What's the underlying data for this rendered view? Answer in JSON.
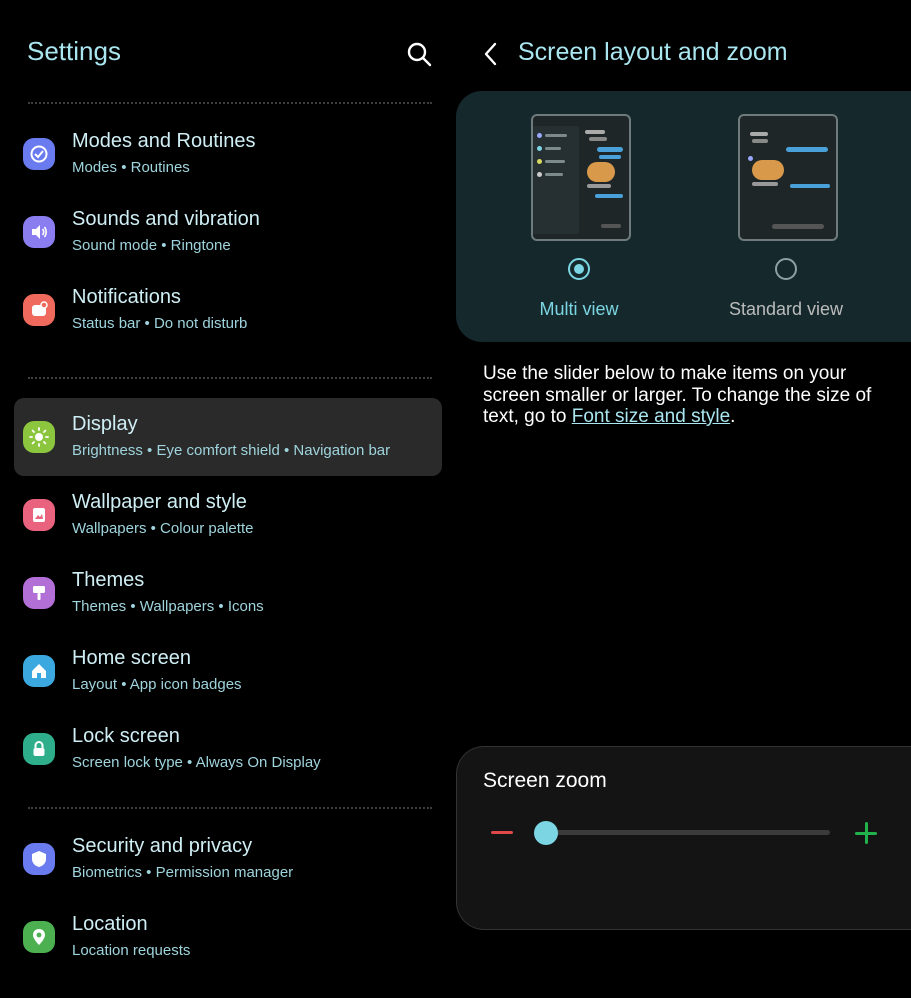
{
  "settings": {
    "title": "Settings",
    "items": [
      {
        "title": "Modes and Routines",
        "sub": "Modes  •  Routines",
        "color": "#6a7bf0",
        "icon": "check-circle-icon"
      },
      {
        "title": "Sounds and vibration",
        "sub": "Sound mode  •  Ringtone",
        "color": "#8a7df0",
        "icon": "speaker-icon"
      },
      {
        "title": "Notifications",
        "sub": "Status bar  •  Do not disturb",
        "color": "#ef6a5c",
        "icon": "notification-icon"
      },
      {
        "title": "Display",
        "sub": "Brightness  •  Eye comfort shield  •  Navigation bar",
        "color": "#8cc63f",
        "icon": "sun-icon"
      },
      {
        "title": "Wallpaper and style",
        "sub": "Wallpapers  •  Colour palette",
        "color": "#e9637f",
        "icon": "image-icon"
      },
      {
        "title": "Themes",
        "sub": "Themes  •  Wallpapers  •  Icons",
        "color": "#b26fd6",
        "icon": "paintbrush-icon"
      },
      {
        "title": "Home screen",
        "sub": "Layout  •  App icon badges",
        "color": "#3ba8e0",
        "icon": "home-icon"
      },
      {
        "title": "Lock screen",
        "sub": "Screen lock type  •  Always On Display",
        "color": "#2fae8c",
        "icon": "lock-icon"
      },
      {
        "title": "Security and privacy",
        "sub": "Biometrics  •  Permission manager",
        "color": "#6a7bf0",
        "icon": "shield-icon"
      },
      {
        "title": "Location",
        "sub": "Location requests",
        "color": "#4caf50",
        "icon": "location-pin-icon"
      }
    ]
  },
  "layout_page": {
    "title": "Screen layout and zoom",
    "multi_view_label": "Multi view",
    "standard_view_label": "Standard view",
    "selected_view": "multi",
    "description_prefix": "Use the slider below to make items on your screen smaller or larger. To change the size of text, go to ",
    "description_link": "Font size and style",
    "description_suffix": ".",
    "zoom_label": "Screen zoom",
    "zoom_level": 0.03
  },
  "colors": {
    "accent": "#7cd5e3",
    "title": "#a9e6f0",
    "minus": "#e0484a",
    "plus": "#22b24c"
  }
}
